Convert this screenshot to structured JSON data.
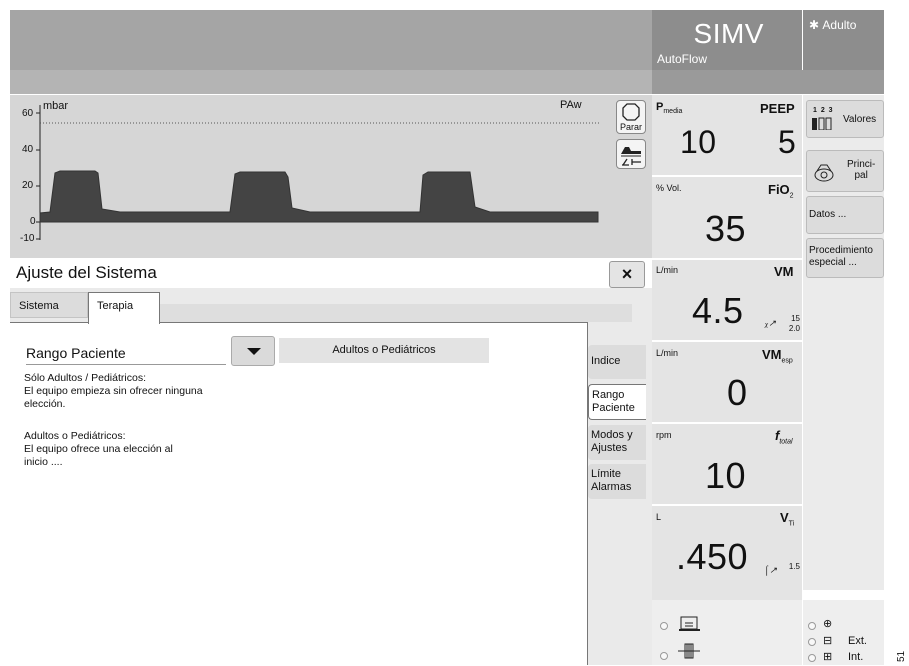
{
  "header": {
    "mode": "SIMV",
    "mode_sub": "AutoFlow",
    "patient": "Adulto"
  },
  "waveform": {
    "unit": "mbar",
    "name": "PAw",
    "y_ticks": [
      "60",
      "40",
      "20",
      "0",
      "-10"
    ],
    "stop_label": "Parar"
  },
  "dialog": {
    "title": "Ajuste del Sistema",
    "close": "×",
    "tabs": [
      "Sistema",
      "Terapia"
    ],
    "param_label": "Rango Paciente",
    "selected_value": "Adultos o Pediátricos",
    "desc1": [
      "Sólo Adultos / Pediátricos:",
      "El equipo empieza sin ofrecer ninguna",
      "elección."
    ],
    "desc2": [
      "Adultos o Pediátricos:",
      "El equipo ofrece una elección al",
      "inicio ...."
    ],
    "side_tabs": [
      [
        "Indice"
      ],
      [
        "Rango",
        "Paciente"
      ],
      [
        "Modos y",
        "Ajustes"
      ],
      [
        "Límite",
        "Alarmas"
      ]
    ]
  },
  "measurements": {
    "pmedia": {
      "name": "P",
      "sub": "media",
      "value": "10"
    },
    "peep": {
      "name": "PEEP",
      "value": "5"
    },
    "fio2": {
      "unit": "% Vol.",
      "name": "FiO",
      "sub": "2",
      "value": "35"
    },
    "vm": {
      "unit": "L/min",
      "name": "VM",
      "value": "4.5",
      "mini1": "15",
      "mini2": "2.0"
    },
    "vmesp": {
      "unit": "L/min",
      "name": "VM",
      "sub": "esp",
      "value": "0"
    },
    "ftotal": {
      "unit": "rpm",
      "name": "f",
      "sub": "total",
      "value": "10"
    },
    "vti": {
      "unit": "L",
      "name": "V",
      "sub": "Ti",
      "value": ".450",
      "mini": "1.5"
    }
  },
  "side_buttons": {
    "valores": "Valores",
    "valores_digits": "1 2 3",
    "principal_1": "Princi-",
    "principal_2": "pal",
    "datos": "Datos ...",
    "proc_1": "Procedimiento",
    "proc_2": "especial ..."
  },
  "power": {
    "ext": "Ext.",
    "int": "Int."
  },
  "figure_number": "51"
}
